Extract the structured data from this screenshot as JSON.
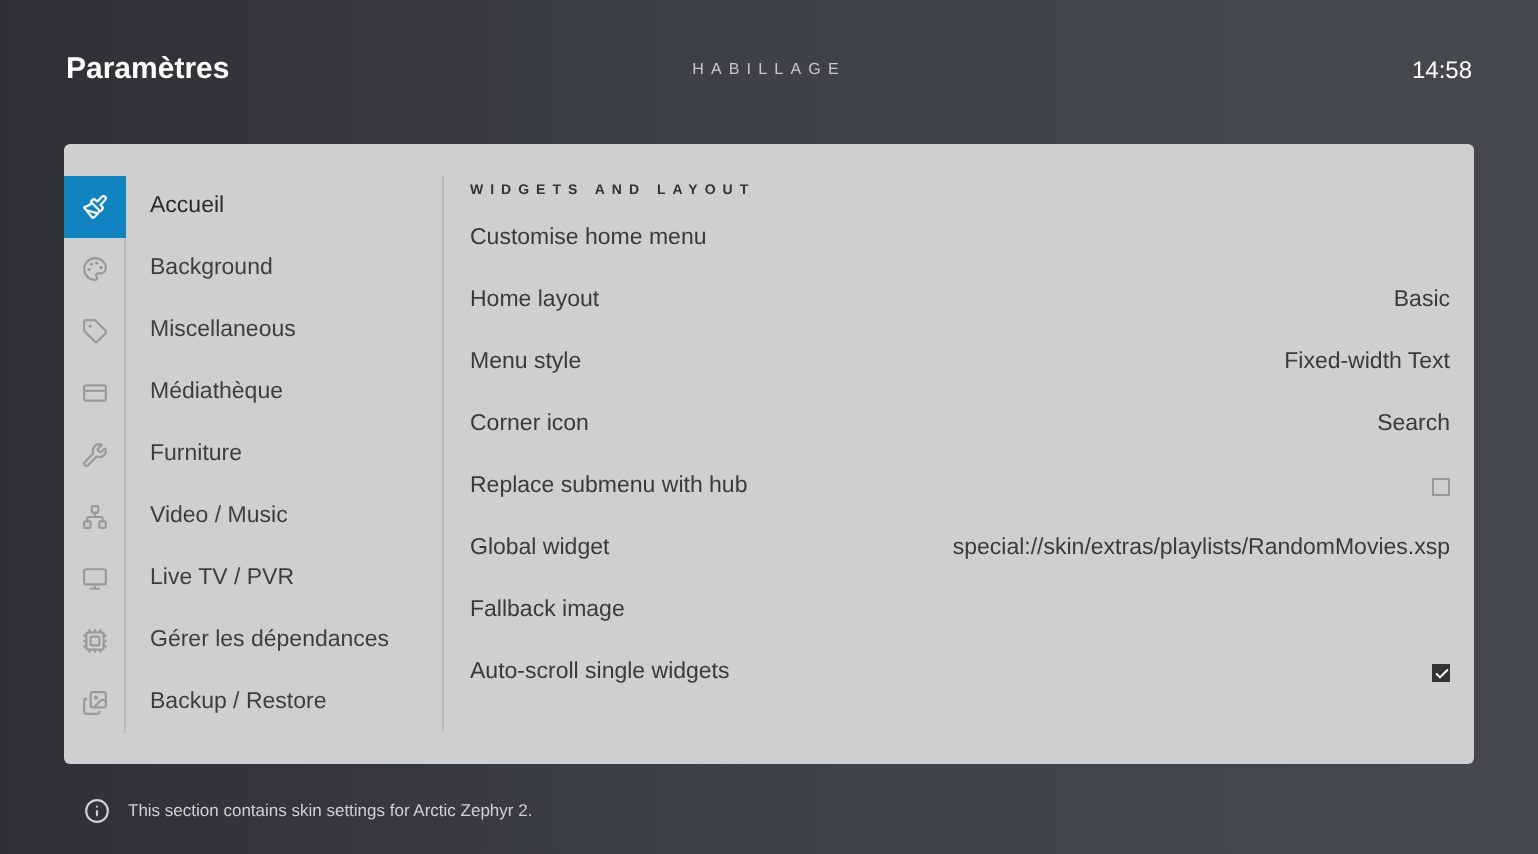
{
  "header": {
    "title": "Paramètres",
    "section": "HABILLAGE",
    "time": "14:58"
  },
  "sidebar": {
    "items": [
      {
        "label": "Accueil",
        "selected": true
      },
      {
        "label": "Background",
        "selected": false
      },
      {
        "label": "Miscellaneous",
        "selected": false
      },
      {
        "label": "Médiathèque",
        "selected": false
      },
      {
        "label": "Furniture",
        "selected": false
      },
      {
        "label": "Video / Music",
        "selected": false
      },
      {
        "label": "Live TV / PVR",
        "selected": false
      },
      {
        "label": "Gérer les dépendances",
        "selected": false
      },
      {
        "label": "Backup / Restore",
        "selected": false
      }
    ]
  },
  "settings": {
    "heading": "WIDGETS AND LAYOUT",
    "rows": [
      {
        "kind": "action",
        "label": "Customise home menu"
      },
      {
        "kind": "value",
        "label": "Home layout",
        "value": "Basic"
      },
      {
        "kind": "value",
        "label": "Menu style",
        "value": "Fixed-width Text"
      },
      {
        "kind": "value",
        "label": "Corner icon",
        "value": "Search"
      },
      {
        "kind": "checkbox",
        "label": "Replace submenu with hub",
        "checked": false
      },
      {
        "kind": "value",
        "label": "Global widget",
        "value": "special://skin/extras/playlists/RandomMovies.xsp"
      },
      {
        "kind": "action",
        "label": "Fallback image"
      },
      {
        "kind": "checkbox",
        "label": "Auto-scroll single widgets",
        "checked": true
      }
    ]
  },
  "footer": {
    "info": "This section contains skin settings for Arctic Zephyr 2."
  }
}
